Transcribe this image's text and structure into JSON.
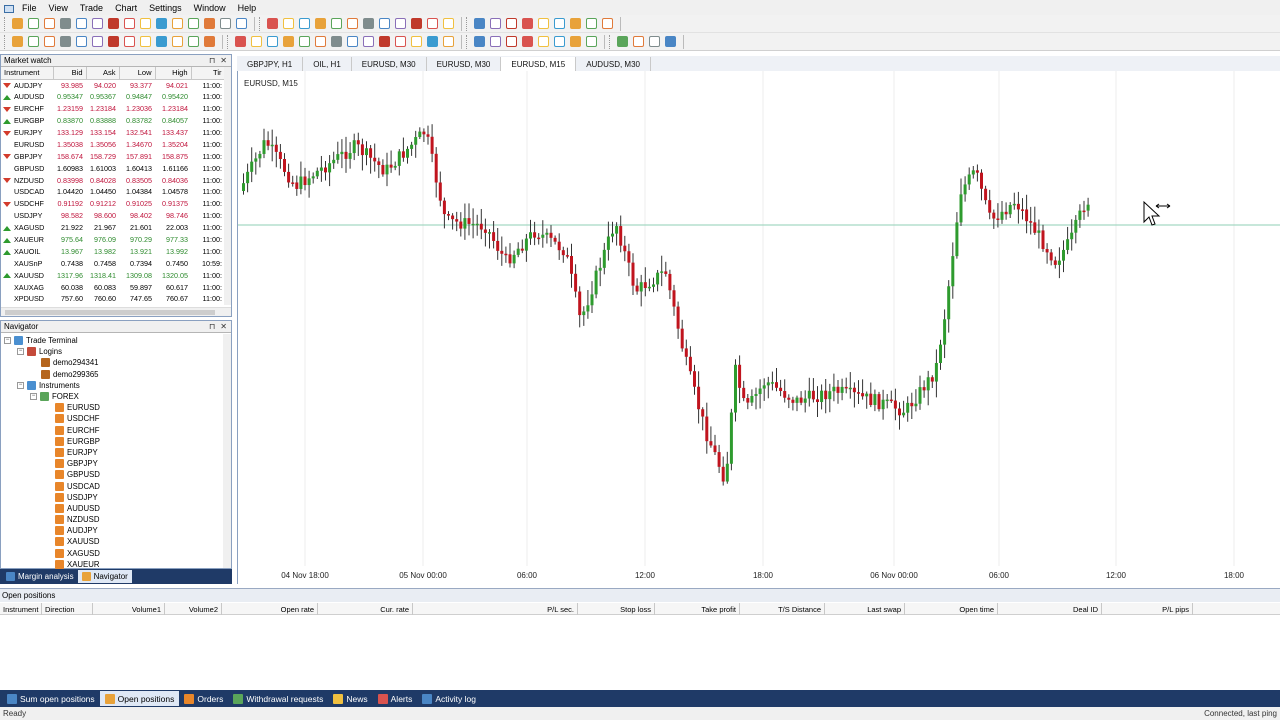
{
  "menu": [
    "File",
    "View",
    "Trade",
    "Chart",
    "Settings",
    "Window",
    "Help"
  ],
  "market_watch": {
    "title": "Market watch",
    "columns": [
      "Instrument",
      "Bid",
      "Ask",
      "Low",
      "High",
      "Tir"
    ],
    "rows": [
      {
        "symbol": "AUDJPY",
        "dir": "down",
        "bid": "93.985",
        "ask": "94.020",
        "low": "93.377",
        "high": "94.021",
        "time": "11:00:",
        "color": "red"
      },
      {
        "symbol": "AUDUSD",
        "dir": "up",
        "bid": "0.95347",
        "ask": "0.95367",
        "low": "0.94847",
        "high": "0.95420",
        "time": "11:00:",
        "color": "green"
      },
      {
        "symbol": "EURCHF",
        "dir": "down",
        "bid": "1.23159",
        "ask": "1.23184",
        "low": "1.23036",
        "high": "1.23184",
        "time": "11:00:",
        "color": "red"
      },
      {
        "symbol": "EURGBP",
        "dir": "up",
        "bid": "0.83870",
        "ask": "0.83888",
        "low": "0.83782",
        "high": "0.84057",
        "time": "11:00:",
        "color": "green"
      },
      {
        "symbol": "EURJPY",
        "dir": "down",
        "bid": "133.129",
        "ask": "133.154",
        "low": "132.541",
        "high": "133.437",
        "time": "11:00:",
        "color": "red"
      },
      {
        "symbol": "EURUSD",
        "dir": "none",
        "bid": "1.35038",
        "ask": "1.35056",
        "low": "1.34670",
        "high": "1.35204",
        "time": "11:00:",
        "color": "red"
      },
      {
        "symbol": "GBPJPY",
        "dir": "down",
        "bid": "158.674",
        "ask": "158.729",
        "low": "157.891",
        "high": "158.875",
        "time": "11:00:",
        "color": "red"
      },
      {
        "symbol": "GBPUSD",
        "dir": "none",
        "bid": "1.60983",
        "ask": "1.61003",
        "low": "1.60413",
        "high": "1.61166",
        "time": "11:00:",
        "color": "black"
      },
      {
        "symbol": "NZDUSD",
        "dir": "down",
        "bid": "0.83998",
        "ask": "0.84028",
        "low": "0.83505",
        "high": "0.84036",
        "time": "11:00:",
        "color": "red"
      },
      {
        "symbol": "USDCAD",
        "dir": "none",
        "bid": "1.04420",
        "ask": "1.04450",
        "low": "1.04384",
        "high": "1.04578",
        "time": "11:00:",
        "color": "black"
      },
      {
        "symbol": "USDCHF",
        "dir": "down",
        "bid": "0.91192",
        "ask": "0.91212",
        "low": "0.91025",
        "high": "0.91375",
        "time": "11:00:",
        "color": "red"
      },
      {
        "symbol": "USDJPY",
        "dir": "none",
        "bid": "98.582",
        "ask": "98.600",
        "low": "98.402",
        "high": "98.746",
        "time": "11:00:",
        "color": "red"
      },
      {
        "symbol": "XAGUSD",
        "dir": "up",
        "bid": "21.922",
        "ask": "21.967",
        "low": "21.601",
        "high": "22.003",
        "time": "11:00:",
        "color": "black"
      },
      {
        "symbol": "XAUEUR",
        "dir": "up",
        "bid": "975.64",
        "ask": "976.09",
        "low": "970.29",
        "high": "977.33",
        "time": "11:00:",
        "color": "green"
      },
      {
        "symbol": "XAUOIL",
        "dir": "up",
        "bid": "13.967",
        "ask": "13.982",
        "low": "13.921",
        "high": "13.992",
        "time": "11:00:",
        "color": "green"
      },
      {
        "symbol": "XAUSnP",
        "dir": "none",
        "bid": "0.7438",
        "ask": "0.7458",
        "low": "0.7394",
        "high": "0.7450",
        "time": "10:59:",
        "color": "black"
      },
      {
        "symbol": "XAUUSD",
        "dir": "up",
        "bid": "1317.96",
        "ask": "1318.41",
        "low": "1309.08",
        "high": "1320.05",
        "time": "11:00:",
        "color": "green"
      },
      {
        "symbol": "XAUXAG",
        "dir": "none",
        "bid": "60.038",
        "ask": "60.083",
        "low": "59.897",
        "high": "60.617",
        "time": "11:00:",
        "color": "black"
      },
      {
        "symbol": "XPDUSD",
        "dir": "none",
        "bid": "757.60",
        "ask": "760.60",
        "low": "747.65",
        "high": "760.67",
        "time": "11:00:",
        "color": "black"
      }
    ]
  },
  "navigator": {
    "title": "Navigator",
    "root": "Trade Terminal",
    "logins_label": "Logins",
    "logins": [
      "demo294341",
      "demo299365"
    ],
    "instruments_label": "Instruments",
    "forex_label": "FOREX",
    "forex": [
      "EURUSD",
      "USDCHF",
      "EURCHF",
      "EURGBP",
      "EURJPY",
      "GBPJPY",
      "GBPUSD",
      "USDCAD",
      "USDJPY",
      "AUDUSD",
      "NZDUSD",
      "AUDJPY",
      "XAUUSD",
      "XAGUSD",
      "XAUEUR"
    ]
  },
  "left_tabs": [
    {
      "label": "Margin analysis",
      "active": false
    },
    {
      "label": "Navigator",
      "active": true
    }
  ],
  "chart_tabs": [
    {
      "label": "GBPJPY, H1",
      "active": false
    },
    {
      "label": "OIL, H1",
      "active": false
    },
    {
      "label": "EURUSD, M30",
      "active": false
    },
    {
      "label": "EURUSD, M30",
      "active": false
    },
    {
      "label": "EURUSD, M15",
      "active": true
    },
    {
      "label": "AUDUSD, M30",
      "active": false
    }
  ],
  "chart": {
    "label": "EURUSD, M15",
    "x_labels": [
      "04 Nov 18:00",
      "05 Nov 00:00",
      "06:00",
      "12:00",
      "18:00",
      "06 Nov 00:00",
      "06:00",
      "12:00",
      "18:00"
    ],
    "colors": {
      "bull": "#2e9b2e",
      "bear": "#c0141e",
      "wick": "#333333",
      "hline": "#8fcfb6"
    }
  },
  "open_positions": {
    "title": "Open positions",
    "columns": [
      "Instrument",
      "Direction",
      "Volume1",
      "Volume2",
      "Open rate",
      "Cur. rate",
      "P/L sec.",
      "Stop loss",
      "Take profit",
      "T/S Distance",
      "Last swap",
      "Open time",
      "Deal ID",
      "P/L pips"
    ]
  },
  "bottom_tabs": [
    {
      "label": "Sum open positions",
      "active": false
    },
    {
      "label": "Open positions",
      "active": true
    },
    {
      "label": "Orders",
      "active": false
    },
    {
      "label": "Withdrawal requests",
      "active": false
    },
    {
      "label": "News",
      "active": false
    },
    {
      "label": "Alerts",
      "active": false
    },
    {
      "label": "Activity log",
      "active": false
    }
  ],
  "status": {
    "left": "Ready",
    "right": "Connected, last ping"
  }
}
